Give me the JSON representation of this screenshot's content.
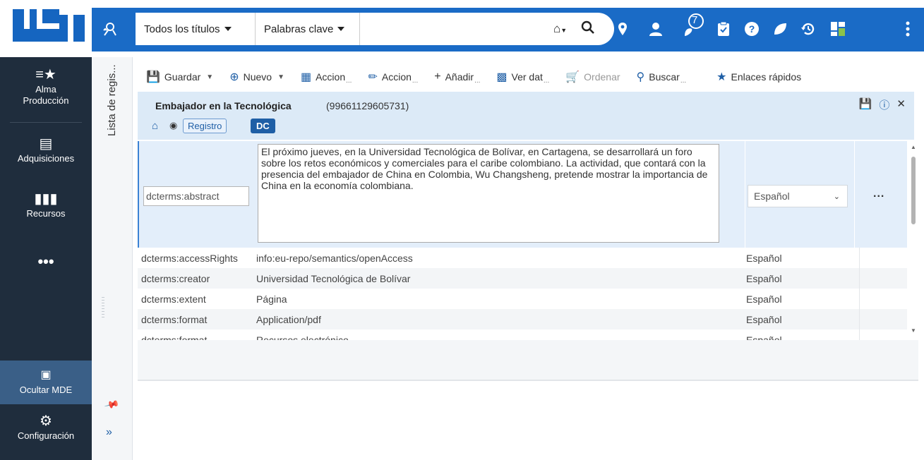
{
  "top_search": {
    "scope_label": "Todos los títulos",
    "type_label": "Palabras clave",
    "query": "",
    "notification_count": "7"
  },
  "left_nav": [
    {
      "label": "Alma\nProducción"
    },
    {
      "label": "Adquisiciones"
    },
    {
      "label": "Recursos"
    },
    {
      "label": "Ocultar MDE"
    },
    {
      "label": "Configuración"
    }
  ],
  "side_panel": {
    "label": "Lista de regis..."
  },
  "toolbar": {
    "save": "Guardar",
    "new": "Nuevo",
    "actions1": "Accion",
    "actions2": "Accion",
    "add": "Añadir",
    "view": "Ver dat",
    "order": "Ordenar",
    "search": "Buscar",
    "quick_links": "Enlaces rápidos"
  },
  "record": {
    "title": "Embajador en la Tecnológica",
    "id": "(99661129605731)",
    "tab_registro": "Registro",
    "tab_dc": "DC"
  },
  "edit_row": {
    "tag": "dcterms:abstract",
    "value": "El próximo jueves, en la Universidad Tecnológica de Bolívar, en Cartagena, se desarrollará un foro sobre los retos económicos y comerciales para el caribe colombiano. La actividad, que contará con la presencia del embajador de China en Colombia, Wu Changsheng, pretende mostrar la importancia de China en la economía colombiana.",
    "language": "Español",
    "more": "..."
  },
  "rows": [
    {
      "tag": "dcterms:accessRights",
      "value": "info:eu-repo/semantics/openAccess",
      "lang": "Español"
    },
    {
      "tag": "dcterms:creator",
      "value": "Universidad Tecnológica de Bolívar",
      "lang": "Español"
    },
    {
      "tag": "dcterms:extent",
      "value": "Página",
      "lang": "Español"
    },
    {
      "tag": "dcterms:format",
      "value": "Application/pdf",
      "lang": "Español"
    },
    {
      "tag": "dcterms:format",
      "value": "Recursos electrónico",
      "lang": "Español"
    }
  ],
  "colors": {
    "brand_blue": "#1a6bc6",
    "nav_dark": "#1f2d3d",
    "header_blue": "#dceaf7"
  }
}
